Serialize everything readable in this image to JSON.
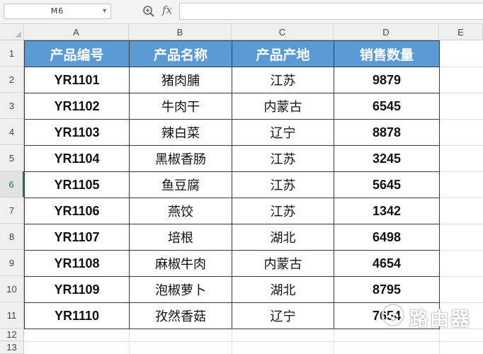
{
  "formula_bar": {
    "name_box": "M6",
    "fx_label": "fx",
    "formula": ""
  },
  "columns": [
    "A",
    "B",
    "C",
    "D",
    "E"
  ],
  "rows": [
    "1",
    "2",
    "3",
    "4",
    "5",
    "6",
    "7",
    "8",
    "9",
    "10",
    "11",
    "12",
    "13"
  ],
  "active_row": "6",
  "table": {
    "header": [
      "产品编号",
      "产品名称",
      "产品产地",
      "销售数量"
    ],
    "rows": [
      [
        "YR1101",
        "猪肉脯",
        "江苏",
        "9879"
      ],
      [
        "YR1102",
        "牛肉干",
        "内蒙古",
        "6545"
      ],
      [
        "YR1103",
        "辣白菜",
        "辽宁",
        "8878"
      ],
      [
        "YR1104",
        "黑椒香肠",
        "江苏",
        "3245"
      ],
      [
        "YR1105",
        "鱼豆腐",
        "江苏",
        "5645"
      ],
      [
        "YR1106",
        "燕饺",
        "江苏",
        "1342"
      ],
      [
        "YR1107",
        "培根",
        "湖北",
        "6498"
      ],
      [
        "YR1108",
        "麻椒牛肉",
        "内蒙古",
        "4654"
      ],
      [
        "YR1109",
        "泡椒萝卜",
        "湖北",
        "8795"
      ],
      [
        "YR1110",
        "孜然香菇",
        "辽宁",
        "7654"
      ]
    ]
  },
  "watermark": {
    "text": "路由器"
  },
  "colors": {
    "header_fill": "#5b9bd5",
    "header_text": "#ffffff",
    "active_row_accent": "#217346"
  }
}
